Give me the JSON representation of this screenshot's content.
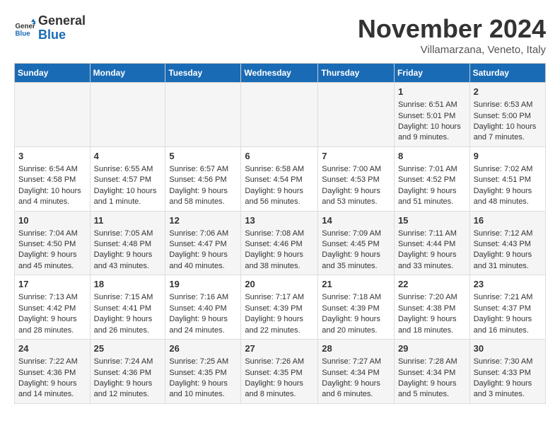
{
  "logo": {
    "text_general": "General",
    "text_blue": "Blue"
  },
  "title": "November 2024",
  "location": "Villamarzana, Veneto, Italy",
  "days_of_week": [
    "Sunday",
    "Monday",
    "Tuesday",
    "Wednesday",
    "Thursday",
    "Friday",
    "Saturday"
  ],
  "weeks": [
    [
      {
        "day": "",
        "info": ""
      },
      {
        "day": "",
        "info": ""
      },
      {
        "day": "",
        "info": ""
      },
      {
        "day": "",
        "info": ""
      },
      {
        "day": "",
        "info": ""
      },
      {
        "day": "1",
        "info": "Sunrise: 6:51 AM\nSunset: 5:01 PM\nDaylight: 10 hours and 9 minutes."
      },
      {
        "day": "2",
        "info": "Sunrise: 6:53 AM\nSunset: 5:00 PM\nDaylight: 10 hours and 7 minutes."
      }
    ],
    [
      {
        "day": "3",
        "info": "Sunrise: 6:54 AM\nSunset: 4:58 PM\nDaylight: 10 hours and 4 minutes."
      },
      {
        "day": "4",
        "info": "Sunrise: 6:55 AM\nSunset: 4:57 PM\nDaylight: 10 hours and 1 minute."
      },
      {
        "day": "5",
        "info": "Sunrise: 6:57 AM\nSunset: 4:56 PM\nDaylight: 9 hours and 58 minutes."
      },
      {
        "day": "6",
        "info": "Sunrise: 6:58 AM\nSunset: 4:54 PM\nDaylight: 9 hours and 56 minutes."
      },
      {
        "day": "7",
        "info": "Sunrise: 7:00 AM\nSunset: 4:53 PM\nDaylight: 9 hours and 53 minutes."
      },
      {
        "day": "8",
        "info": "Sunrise: 7:01 AM\nSunset: 4:52 PM\nDaylight: 9 hours and 51 minutes."
      },
      {
        "day": "9",
        "info": "Sunrise: 7:02 AM\nSunset: 4:51 PM\nDaylight: 9 hours and 48 minutes."
      }
    ],
    [
      {
        "day": "10",
        "info": "Sunrise: 7:04 AM\nSunset: 4:50 PM\nDaylight: 9 hours and 45 minutes."
      },
      {
        "day": "11",
        "info": "Sunrise: 7:05 AM\nSunset: 4:48 PM\nDaylight: 9 hours and 43 minutes."
      },
      {
        "day": "12",
        "info": "Sunrise: 7:06 AM\nSunset: 4:47 PM\nDaylight: 9 hours and 40 minutes."
      },
      {
        "day": "13",
        "info": "Sunrise: 7:08 AM\nSunset: 4:46 PM\nDaylight: 9 hours and 38 minutes."
      },
      {
        "day": "14",
        "info": "Sunrise: 7:09 AM\nSunset: 4:45 PM\nDaylight: 9 hours and 35 minutes."
      },
      {
        "day": "15",
        "info": "Sunrise: 7:11 AM\nSunset: 4:44 PM\nDaylight: 9 hours and 33 minutes."
      },
      {
        "day": "16",
        "info": "Sunrise: 7:12 AM\nSunset: 4:43 PM\nDaylight: 9 hours and 31 minutes."
      }
    ],
    [
      {
        "day": "17",
        "info": "Sunrise: 7:13 AM\nSunset: 4:42 PM\nDaylight: 9 hours and 28 minutes."
      },
      {
        "day": "18",
        "info": "Sunrise: 7:15 AM\nSunset: 4:41 PM\nDaylight: 9 hours and 26 minutes."
      },
      {
        "day": "19",
        "info": "Sunrise: 7:16 AM\nSunset: 4:40 PM\nDaylight: 9 hours and 24 minutes."
      },
      {
        "day": "20",
        "info": "Sunrise: 7:17 AM\nSunset: 4:39 PM\nDaylight: 9 hours and 22 minutes."
      },
      {
        "day": "21",
        "info": "Sunrise: 7:18 AM\nSunset: 4:39 PM\nDaylight: 9 hours and 20 minutes."
      },
      {
        "day": "22",
        "info": "Sunrise: 7:20 AM\nSunset: 4:38 PM\nDaylight: 9 hours and 18 minutes."
      },
      {
        "day": "23",
        "info": "Sunrise: 7:21 AM\nSunset: 4:37 PM\nDaylight: 9 hours and 16 minutes."
      }
    ],
    [
      {
        "day": "24",
        "info": "Sunrise: 7:22 AM\nSunset: 4:36 PM\nDaylight: 9 hours and 14 minutes."
      },
      {
        "day": "25",
        "info": "Sunrise: 7:24 AM\nSunset: 4:36 PM\nDaylight: 9 hours and 12 minutes."
      },
      {
        "day": "26",
        "info": "Sunrise: 7:25 AM\nSunset: 4:35 PM\nDaylight: 9 hours and 10 minutes."
      },
      {
        "day": "27",
        "info": "Sunrise: 7:26 AM\nSunset: 4:35 PM\nDaylight: 9 hours and 8 minutes."
      },
      {
        "day": "28",
        "info": "Sunrise: 7:27 AM\nSunset: 4:34 PM\nDaylight: 9 hours and 6 minutes."
      },
      {
        "day": "29",
        "info": "Sunrise: 7:28 AM\nSunset: 4:34 PM\nDaylight: 9 hours and 5 minutes."
      },
      {
        "day": "30",
        "info": "Sunrise: 7:30 AM\nSunset: 4:33 PM\nDaylight: 9 hours and 3 minutes."
      }
    ]
  ]
}
